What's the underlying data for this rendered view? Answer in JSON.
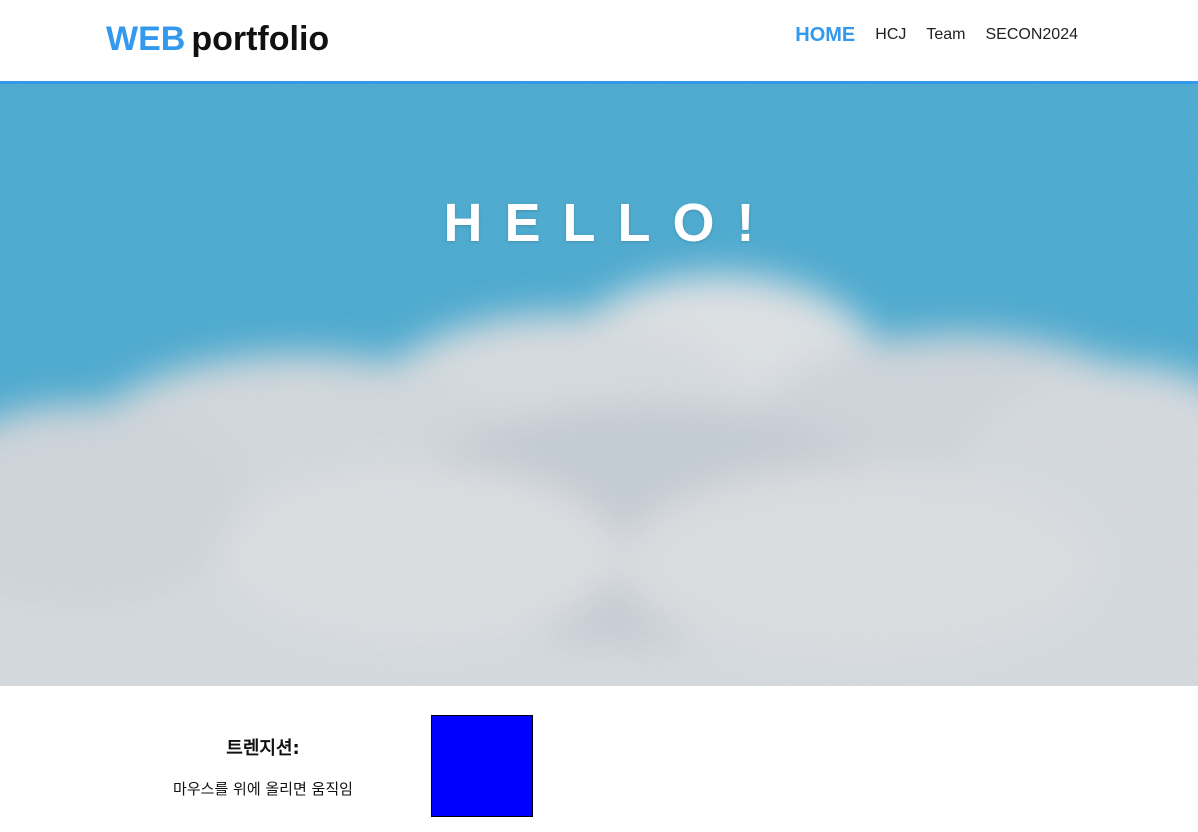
{
  "header": {
    "logo_accent": "WEB",
    "logo_rest": "portfolio",
    "accent_color": "#3399ee",
    "nav": [
      {
        "label": "HOME",
        "active": true
      },
      {
        "label": "HCJ",
        "active": false
      },
      {
        "label": "Team",
        "active": false
      },
      {
        "label": "SECON2024",
        "active": false
      }
    ]
  },
  "hero": {
    "title": "HELLO!",
    "image": "sky-with-clouds"
  },
  "demo": {
    "title": "트렌지션:",
    "description": "마우스를 위에 올리면 움직임",
    "box_color": "#0000ff"
  }
}
